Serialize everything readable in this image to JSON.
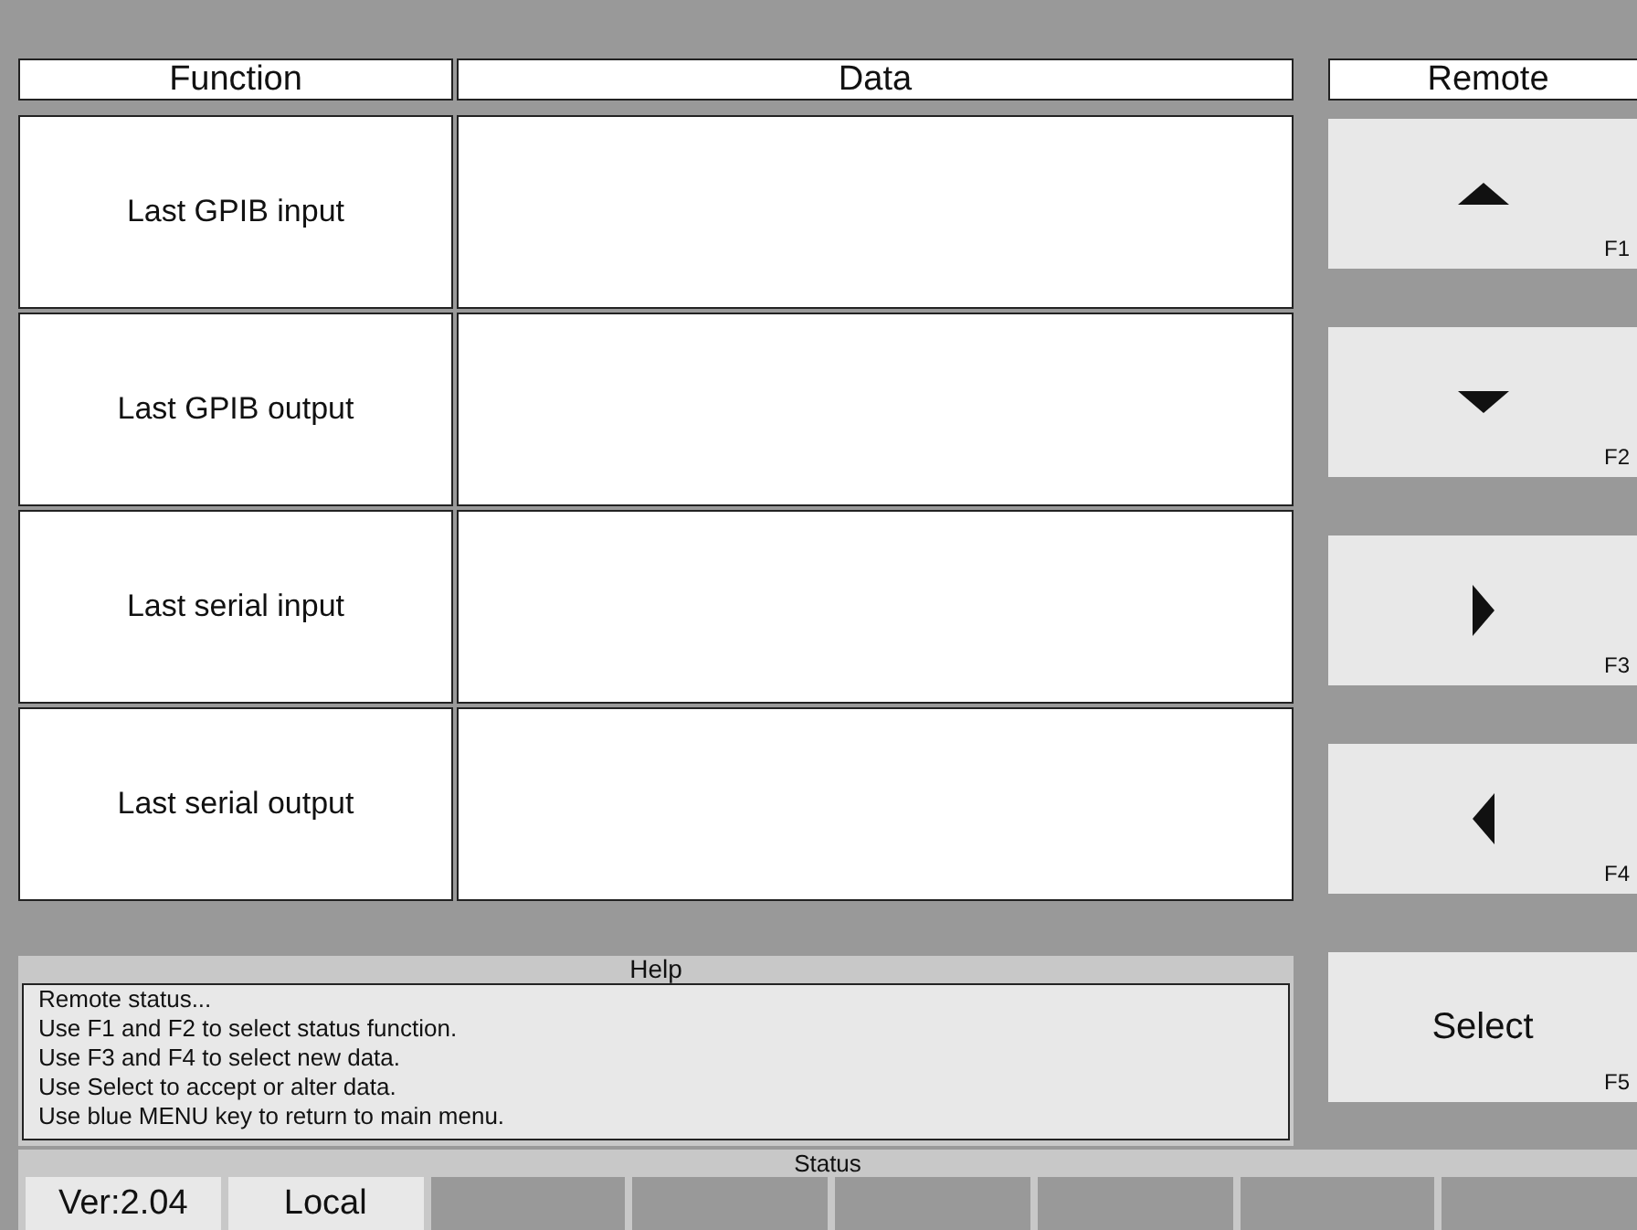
{
  "table": {
    "columns": [
      "Function",
      "Data"
    ],
    "rows": [
      {
        "function": "Last GPIB input"
      },
      {
        "function": "Last GPIB output"
      },
      {
        "function": "Last serial input"
      },
      {
        "function": "Last serial output"
      }
    ]
  },
  "remote": {
    "title": "Remote",
    "keys": [
      {
        "kind": "up",
        "key": "F1"
      },
      {
        "kind": "down",
        "key": "F2"
      },
      {
        "kind": "right",
        "key": "F3"
      },
      {
        "kind": "left",
        "key": "F4"
      },
      {
        "kind": "label",
        "label": "Select",
        "key": "F5"
      }
    ]
  },
  "help": {
    "title": "Help",
    "lines": [
      "Remote status...",
      "Use F1 and F2 to select status function.",
      "Use F3 and F4 to select new data.",
      "Use Select to accept or alter data.",
      "Use blue MENU key to return to main menu."
    ]
  },
  "status": {
    "title": "Status",
    "fields": [
      "Ver:2.04",
      "Local"
    ]
  }
}
